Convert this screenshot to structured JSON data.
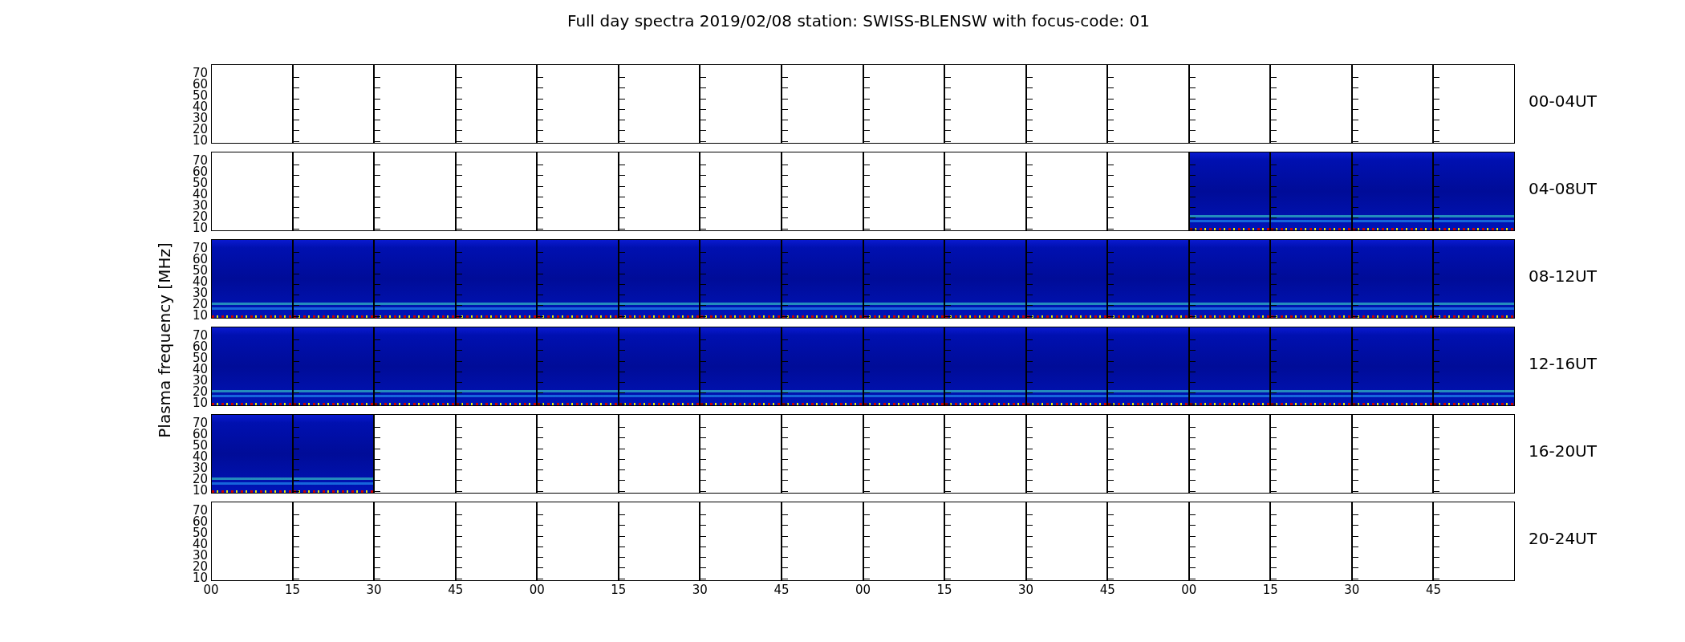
{
  "title": "Full day spectra 2019/02/08 station: SWISS-BLENSW with focus-code: 01",
  "ylabel": "Plasma frequency [MHz]",
  "rows": [
    {
      "label": "00-04UT",
      "yticks": [
        "70",
        "60",
        "50",
        "40",
        "30",
        "20",
        "10"
      ],
      "segments": [
        {
          "has_data": false
        },
        {
          "has_data": false
        },
        {
          "has_data": false
        },
        {
          "has_data": false
        },
        {
          "has_data": false
        },
        {
          "has_data": false
        },
        {
          "has_data": false
        },
        {
          "has_data": false
        },
        {
          "has_data": false
        },
        {
          "has_data": false
        },
        {
          "has_data": false
        },
        {
          "has_data": false
        },
        {
          "has_data": false
        },
        {
          "has_data": false
        },
        {
          "has_data": false
        },
        {
          "has_data": false
        }
      ]
    },
    {
      "label": "04-08UT",
      "yticks": [
        "70",
        "60",
        "50",
        "40",
        "30",
        "20",
        "10"
      ],
      "segments": [
        {
          "has_data": false
        },
        {
          "has_data": false
        },
        {
          "has_data": false
        },
        {
          "has_data": false
        },
        {
          "has_data": false
        },
        {
          "has_data": false
        },
        {
          "has_data": false
        },
        {
          "has_data": false
        },
        {
          "has_data": false
        },
        {
          "has_data": false
        },
        {
          "has_data": false
        },
        {
          "has_data": false
        },
        {
          "has_data": true
        },
        {
          "has_data": true
        },
        {
          "has_data": true
        },
        {
          "has_data": true
        }
      ]
    },
    {
      "label": "08-12UT",
      "yticks": [
        "70",
        "60",
        "50",
        "40",
        "30",
        "20",
        "10"
      ],
      "segments": [
        {
          "has_data": true
        },
        {
          "has_data": true
        },
        {
          "has_data": true
        },
        {
          "has_data": true
        },
        {
          "has_data": true
        },
        {
          "has_data": true
        },
        {
          "has_data": true
        },
        {
          "has_data": true
        },
        {
          "has_data": true
        },
        {
          "has_data": true
        },
        {
          "has_data": true
        },
        {
          "has_data": true
        },
        {
          "has_data": true
        },
        {
          "has_data": true
        },
        {
          "has_data": true
        },
        {
          "has_data": true
        }
      ]
    },
    {
      "label": "12-16UT",
      "yticks": [
        "70",
        "60",
        "50",
        "40",
        "30",
        "20",
        "10"
      ],
      "segments": [
        {
          "has_data": true
        },
        {
          "has_data": true
        },
        {
          "has_data": true
        },
        {
          "has_data": true
        },
        {
          "has_data": true
        },
        {
          "has_data": true
        },
        {
          "has_data": true
        },
        {
          "has_data": true
        },
        {
          "has_data": true
        },
        {
          "has_data": true
        },
        {
          "has_data": true
        },
        {
          "has_data": true
        },
        {
          "has_data": true
        },
        {
          "has_data": true
        },
        {
          "has_data": true
        },
        {
          "has_data": true
        }
      ]
    },
    {
      "label": "16-20UT",
      "yticks": [
        "70",
        "60",
        "50",
        "40",
        "30",
        "20",
        "10"
      ],
      "segments": [
        {
          "has_data": true
        },
        {
          "has_data": true
        },
        {
          "has_data": false
        },
        {
          "has_data": false
        },
        {
          "has_data": false
        },
        {
          "has_data": false
        },
        {
          "has_data": false
        },
        {
          "has_data": false
        },
        {
          "has_data": false
        },
        {
          "has_data": false
        },
        {
          "has_data": false
        },
        {
          "has_data": false
        },
        {
          "has_data": false
        },
        {
          "has_data": false
        },
        {
          "has_data": false
        },
        {
          "has_data": false
        }
      ]
    },
    {
      "label": "20-24UT",
      "yticks": [
        "70",
        "60",
        "50",
        "40",
        "30",
        "20",
        "10"
      ],
      "segments": [
        {
          "has_data": false
        },
        {
          "has_data": false
        },
        {
          "has_data": false
        },
        {
          "has_data": false
        },
        {
          "has_data": false
        },
        {
          "has_data": false
        },
        {
          "has_data": false
        },
        {
          "has_data": false
        },
        {
          "has_data": false
        },
        {
          "has_data": false
        },
        {
          "has_data": false
        },
        {
          "has_data": false
        },
        {
          "has_data": false
        },
        {
          "has_data": false
        },
        {
          "has_data": false
        },
        {
          "has_data": false
        }
      ]
    }
  ],
  "xticks": [
    "00",
    "15",
    "30",
    "45",
    "00",
    "15",
    "30",
    "45",
    "00",
    "15",
    "30",
    "45",
    "00",
    "15",
    "30",
    "45"
  ]
}
